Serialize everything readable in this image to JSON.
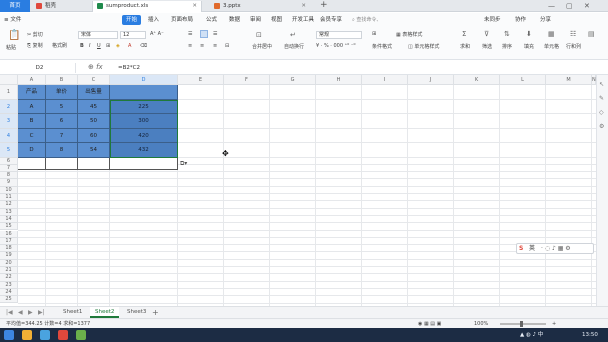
{
  "tabs": {
    "home": "首页",
    "items": [
      {
        "label": "稻壳",
        "color": "#e0483c"
      },
      {
        "label": "sumproduct.xls",
        "color": "#1f8a4c"
      },
      {
        "label": "3.pptx",
        "color": "#e06a2c"
      }
    ],
    "add": "+"
  },
  "window_controls": {
    "minimize": "—",
    "maximize": "▢",
    "close": "✕"
  },
  "menu": {
    "file": "≡ 文件",
    "items": [
      "开始",
      "插入",
      "页面布局",
      "公式",
      "数据",
      "审阅",
      "视图",
      "开发工具",
      "会员专享"
    ],
    "active_index": 0,
    "search": "查找命令、",
    "cloud": "未同步",
    "collab": "协作",
    "share": "分享"
  },
  "ribbon": {
    "cut": "剪切",
    "copy": "复制",
    "format_painter": "格式刷",
    "paste": "粘贴",
    "font_name": "宋体",
    "font_size": "12",
    "merge_center": "合并居中",
    "wrap": "自动换行",
    "number_format": "常规",
    "table_style": "表格样式",
    "cond_format": "条件格式",
    "cell_style": "单元格样式",
    "sum": "求和",
    "filter": "筛选",
    "sort": "排序",
    "fill": "填充",
    "cells": "单元格",
    "rows_cols": "行和列",
    "sheet_tool": "工作表",
    "freeze": "冻结窗格",
    "table_tools": "表格工具"
  },
  "formula_bar": {
    "name_box": "D2",
    "fx": "fx",
    "formula": "=B2*C2"
  },
  "grid": {
    "columns": [
      "A",
      "B",
      "C",
      "D",
      "E",
      "F",
      "G",
      "H",
      "I",
      "J",
      "K",
      "L",
      "M",
      "N",
      "O"
    ],
    "rows": [
      "1",
      "2",
      "3",
      "4",
      "5",
      "6",
      "7",
      "8",
      "9",
      "10",
      "11",
      "12",
      "13",
      "14",
      "15",
      "16",
      "17",
      "18",
      "19",
      "20",
      "21",
      "22",
      "23",
      "24",
      "25",
      "26",
      "27",
      "28",
      "29",
      "30",
      "31",
      "32",
      "33"
    ],
    "table": {
      "header": [
        "产品",
        "单价",
        "出售量",
        ""
      ],
      "data": [
        [
          "A",
          "5",
          "45",
          "225"
        ],
        [
          "B",
          "6",
          "50",
          "300"
        ],
        [
          "C",
          "7",
          "60",
          "420"
        ],
        [
          "D",
          "8",
          "54",
          "432"
        ]
      ]
    }
  },
  "sheets": {
    "nav": [
      "|◀",
      "◀",
      "▶",
      "▶|"
    ],
    "tabs": [
      "Sheet1",
      "Sheet2",
      "Sheet3"
    ],
    "active_index": 1,
    "add": "+"
  },
  "status": {
    "summary": "平均值=344.25  计数=4  求和=1377",
    "zoom": "100%"
  },
  "ime": {
    "label": "英",
    "icons": "· ◌ ♪ ▦ ⚙"
  },
  "clock": "13:50",
  "colors": {
    "accent": "#2a7de1",
    "table_fill": "#5b8fd0",
    "selection": "#1f7a3a",
    "taskbar": "#1c2c44"
  }
}
